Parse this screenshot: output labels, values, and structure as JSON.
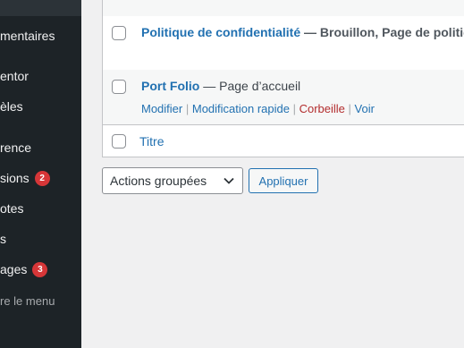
{
  "sidebar": {
    "items": [
      {
        "label": "mentaires",
        "badge": null
      },
      {
        "label": "entor",
        "badge": null
      },
      {
        "label": "èles",
        "badge": null
      },
      {
        "label": "rence",
        "badge": null
      },
      {
        "label": "sions",
        "badge": "2"
      },
      {
        "label": "otes",
        "badge": null
      },
      {
        "label": "s",
        "badge": null
      },
      {
        "label": "ages",
        "badge": "3"
      }
    ],
    "collapse_label": "re le menu"
  },
  "table": {
    "rows": [
      {
        "title": "Politique de confidentialité",
        "state": " — Brouillon, Page de politique"
      },
      {
        "title": "Port Folio",
        "state": " — Page d’accueil",
        "actions": {
          "edit": "Modifier",
          "quick_edit": "Modification rapide",
          "trash": "Corbeille",
          "view": "Voir"
        }
      }
    ],
    "footer_column": "Titre"
  },
  "bulk": {
    "selected": "Actions groupées",
    "apply_label": "Appliquer"
  },
  "colors": {
    "sidebar_bg": "#1d2327",
    "link": "#2271b1",
    "trash": "#b32d2e",
    "badge": "#d63638",
    "page_bg": "#f0f0f1"
  }
}
